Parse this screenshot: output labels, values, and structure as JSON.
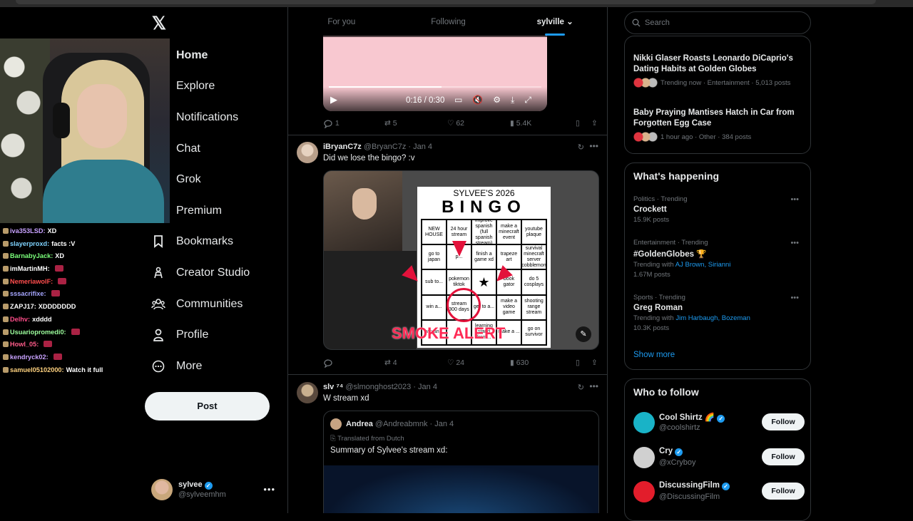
{
  "app": {
    "logo": "𝕏"
  },
  "chat": [
    {
      "user": "iva353LSD:",
      "msg": "XD",
      "color": "#c8a2ff"
    },
    {
      "user": "slayerproxd:",
      "msg": "facts :V",
      "color": "#7fd3ff"
    },
    {
      "user": "BarnabyJack:",
      "msg": "XD",
      "color": "#7bff7b"
    },
    {
      "user": "imMartinMH:",
      "msg": "",
      "color": "#ffffff"
    },
    {
      "user": "NemeriawolF:",
      "msg": "",
      "color": "#ff4d4d"
    },
    {
      "user": "sssacrifixe:",
      "msg": "",
      "color": "#a6a6ff"
    },
    {
      "user": "ZAPJ17:",
      "msg": "XDDDDDDD",
      "color": "#ffffff"
    },
    {
      "user": "Delhv:",
      "msg": "xdddd",
      "color": "#ff4d8a"
    },
    {
      "user": "Usuariopromedi0:",
      "msg": "",
      "color": "#9dff9d"
    },
    {
      "user": "Howl_05:",
      "msg": "",
      "color": "#ff5c8a"
    },
    {
      "user": "kendryck02:",
      "msg": "",
      "color": "#c8a2ff"
    },
    {
      "user": "samuel05102000:",
      "msg": "Watch it full",
      "color": "#ffd27f"
    }
  ],
  "nav": {
    "home": "Home",
    "explore": "Explore",
    "notifications": "Notifications",
    "chat": "Chat",
    "grok": "Grok",
    "premium": "Premium",
    "bookmarks": "Bookmarks",
    "creator_studio": "Creator Studio",
    "communities": "Communities",
    "profile": "Profile",
    "more": "More",
    "post": "Post"
  },
  "account": {
    "name": "sylvee",
    "handle": "@sylveemhm"
  },
  "tabs": {
    "for_you": "For you",
    "following": "Following",
    "list": "sylville"
  },
  "video": {
    "time": "0:16 / 0:30",
    "progress": 0.53
  },
  "tweet0": {
    "replies": "1",
    "reposts": "5",
    "likes": "62",
    "views": "5.4K"
  },
  "tweet1": {
    "name": "iBryanC7z",
    "handle": "@BryanC7z · Jan 4",
    "text": "Did we lose the bingo? :v",
    "replies": "",
    "reposts": "4",
    "likes": "24",
    "views": "630",
    "image": {
      "title": "SYLVEE'S 2026",
      "bingo": "BINGO",
      "overlay": "SMOKE ALERT",
      "cells": [
        "NEW HOUSE",
        "24 hour stream",
        "improve spanish (full spanish stream)",
        "make a minecraft event",
        "youtube plaque",
        "go to japan",
        "p...",
        "finish a game xd",
        "trapeze art",
        "survival minecraft server (cobblemon)",
        "sub to...",
        "pokemon tiktok",
        "★",
        "book gator",
        "do 5 cosplays",
        "win a...",
        "stream 300 days",
        "get to a...",
        "make a video game",
        "shooting range stream",
        "win an...",
        "",
        "learning stand from...",
        "make a ...",
        "go on survivor"
      ]
    }
  },
  "tweet2": {
    "name": "slv ⁷⁴",
    "handle": "@slmonghost2023 · Jan 4",
    "text": "W stream xd",
    "quote": {
      "name": "Andrea",
      "handle": "@Andreabmnk · Jan 4",
      "translated": "Translated from Dutch",
      "text": "Summary of Sylvee's stream xd:"
    }
  },
  "search": {
    "placeholder": "Search"
  },
  "news": [
    {
      "title": "Nikki Glaser Roasts Leonardo DiCaprio's Dating Habits at Golden Globes",
      "meta": "Trending now · Entertainment · 5,013 posts"
    },
    {
      "title": "Baby Praying Mantises Hatch in Car from Forgotten Egg Case",
      "meta": "1 hour ago · Other · 384 posts"
    }
  ],
  "happening": {
    "title": "What's happening",
    "trends": [
      {
        "context": "Politics · Trending",
        "name": "Crockett",
        "posts": "15.9K posts"
      },
      {
        "context": "Entertainment · Trending",
        "name": "#GoldenGlobes 🏆",
        "with": "Trending with ",
        "links": "AJ Brown, Sirianni",
        "posts": "1.67M posts"
      },
      {
        "context": "Sports · Trending",
        "name": "Greg Roman",
        "with": "Trending with ",
        "links": "Jim Harbaugh, Bozeman",
        "posts": "10.3K posts"
      }
    ],
    "show_more": "Show more"
  },
  "who": {
    "title": "Who to follow",
    "accounts": [
      {
        "name": "Cool Shirtz 🌈",
        "handle": "@coolshirtz",
        "follow": "Follow",
        "color": "#19b3c7"
      },
      {
        "name": "Cry",
        "handle": "@xCryboy",
        "follow": "Follow",
        "color": "#d0d0d0"
      },
      {
        "name": "DiscussingFilm",
        "handle": "@DiscussingFilm",
        "follow": "Follow",
        "color": "#e21d2b"
      }
    ]
  }
}
